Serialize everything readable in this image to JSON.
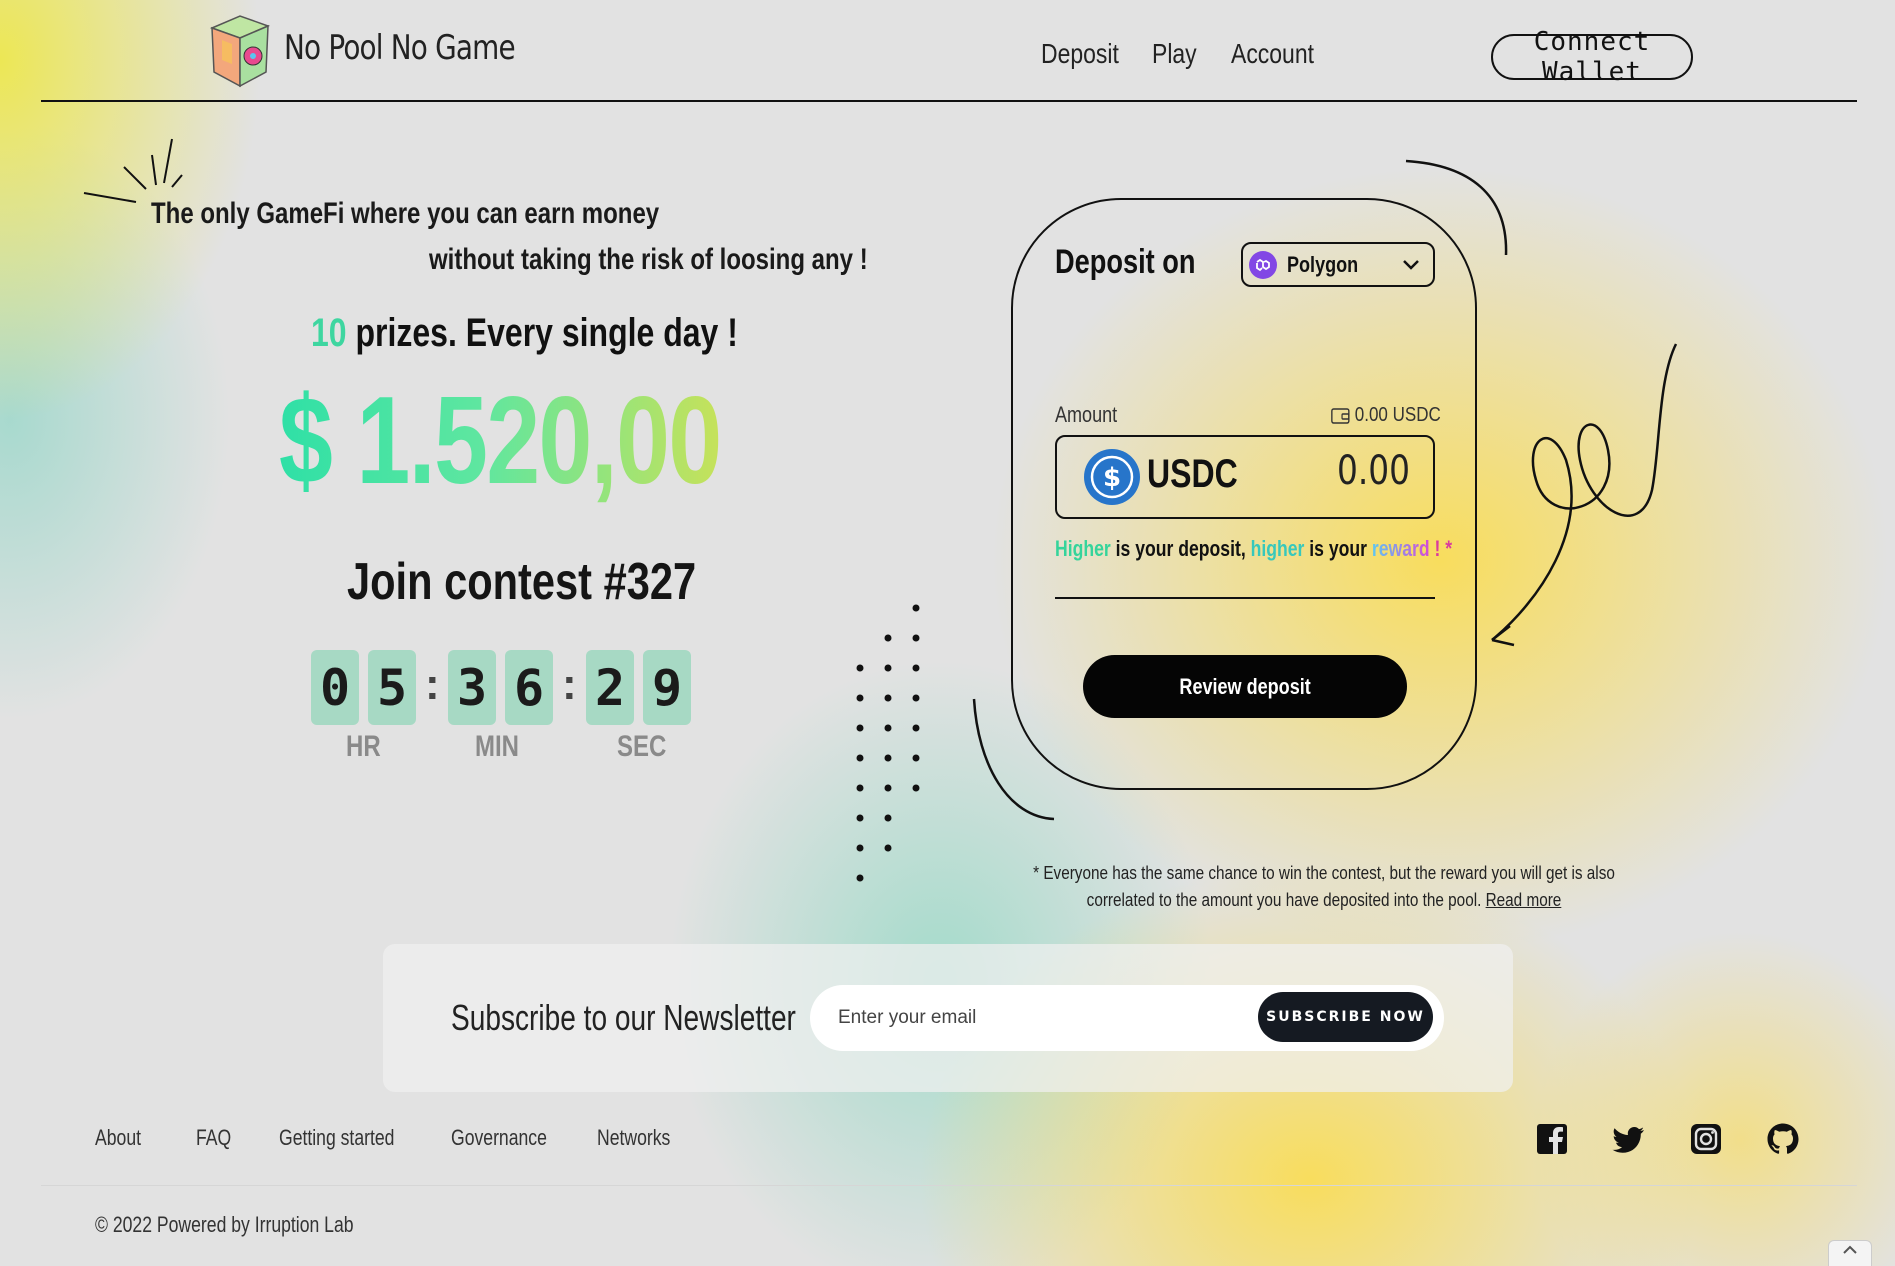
{
  "header": {
    "brand": "No Pool No Game",
    "nav": [
      "Deposit",
      "Play",
      "Account"
    ],
    "connect_label": "Connect Wallet"
  },
  "hero": {
    "tagline_line1": "The only GameFi where you can earn money",
    "tagline_line2": "without taking the risk of loosing any !",
    "prizes_count": "10",
    "prizes_text": " prizes. Every single day !",
    "prize_amount": "$ 1.520,00",
    "contest_title": "Join contest #327",
    "countdown": {
      "digits": [
        "0",
        "5",
        "3",
        "6",
        "2",
        "9"
      ],
      "labels": [
        "HR",
        "MIN",
        "SEC"
      ],
      "separator": ":"
    }
  },
  "deposit": {
    "title": "Deposit on",
    "network": "Polygon",
    "amount_label": "Amount",
    "balance": "0.00 USDC",
    "token": "USDC",
    "amount_value": "0.00",
    "hint": {
      "w1": "Higher",
      "w2": " is your deposit, ",
      "w3": "higher",
      "w4": " is your ",
      "w5": "reward",
      "w6": " ! *"
    },
    "review_label": "Review deposit",
    "note": "* Everyone has the same chance to win the contest, but the reward you will get is also correlated to the amount you have deposited into the pool.",
    "read_more": "Read more"
  },
  "newsletter": {
    "title": "Subscribe to our Newsletter",
    "placeholder": "Enter your email",
    "button": "SUBSCRIBE NOW"
  },
  "footer": {
    "links": [
      "About",
      "FAQ",
      "Getting started",
      "Governance",
      "Networks"
    ],
    "socials": [
      "facebook-icon",
      "twitter-icon",
      "instagram-icon",
      "github-icon"
    ],
    "copyright": "© 2022 Powered by Irruption Lab"
  },
  "colors": {
    "accent_green": "#3ed6a0",
    "digit_bg": "#a7d9c4",
    "polygon": "#8247e5",
    "usdc": "#2775ca"
  }
}
